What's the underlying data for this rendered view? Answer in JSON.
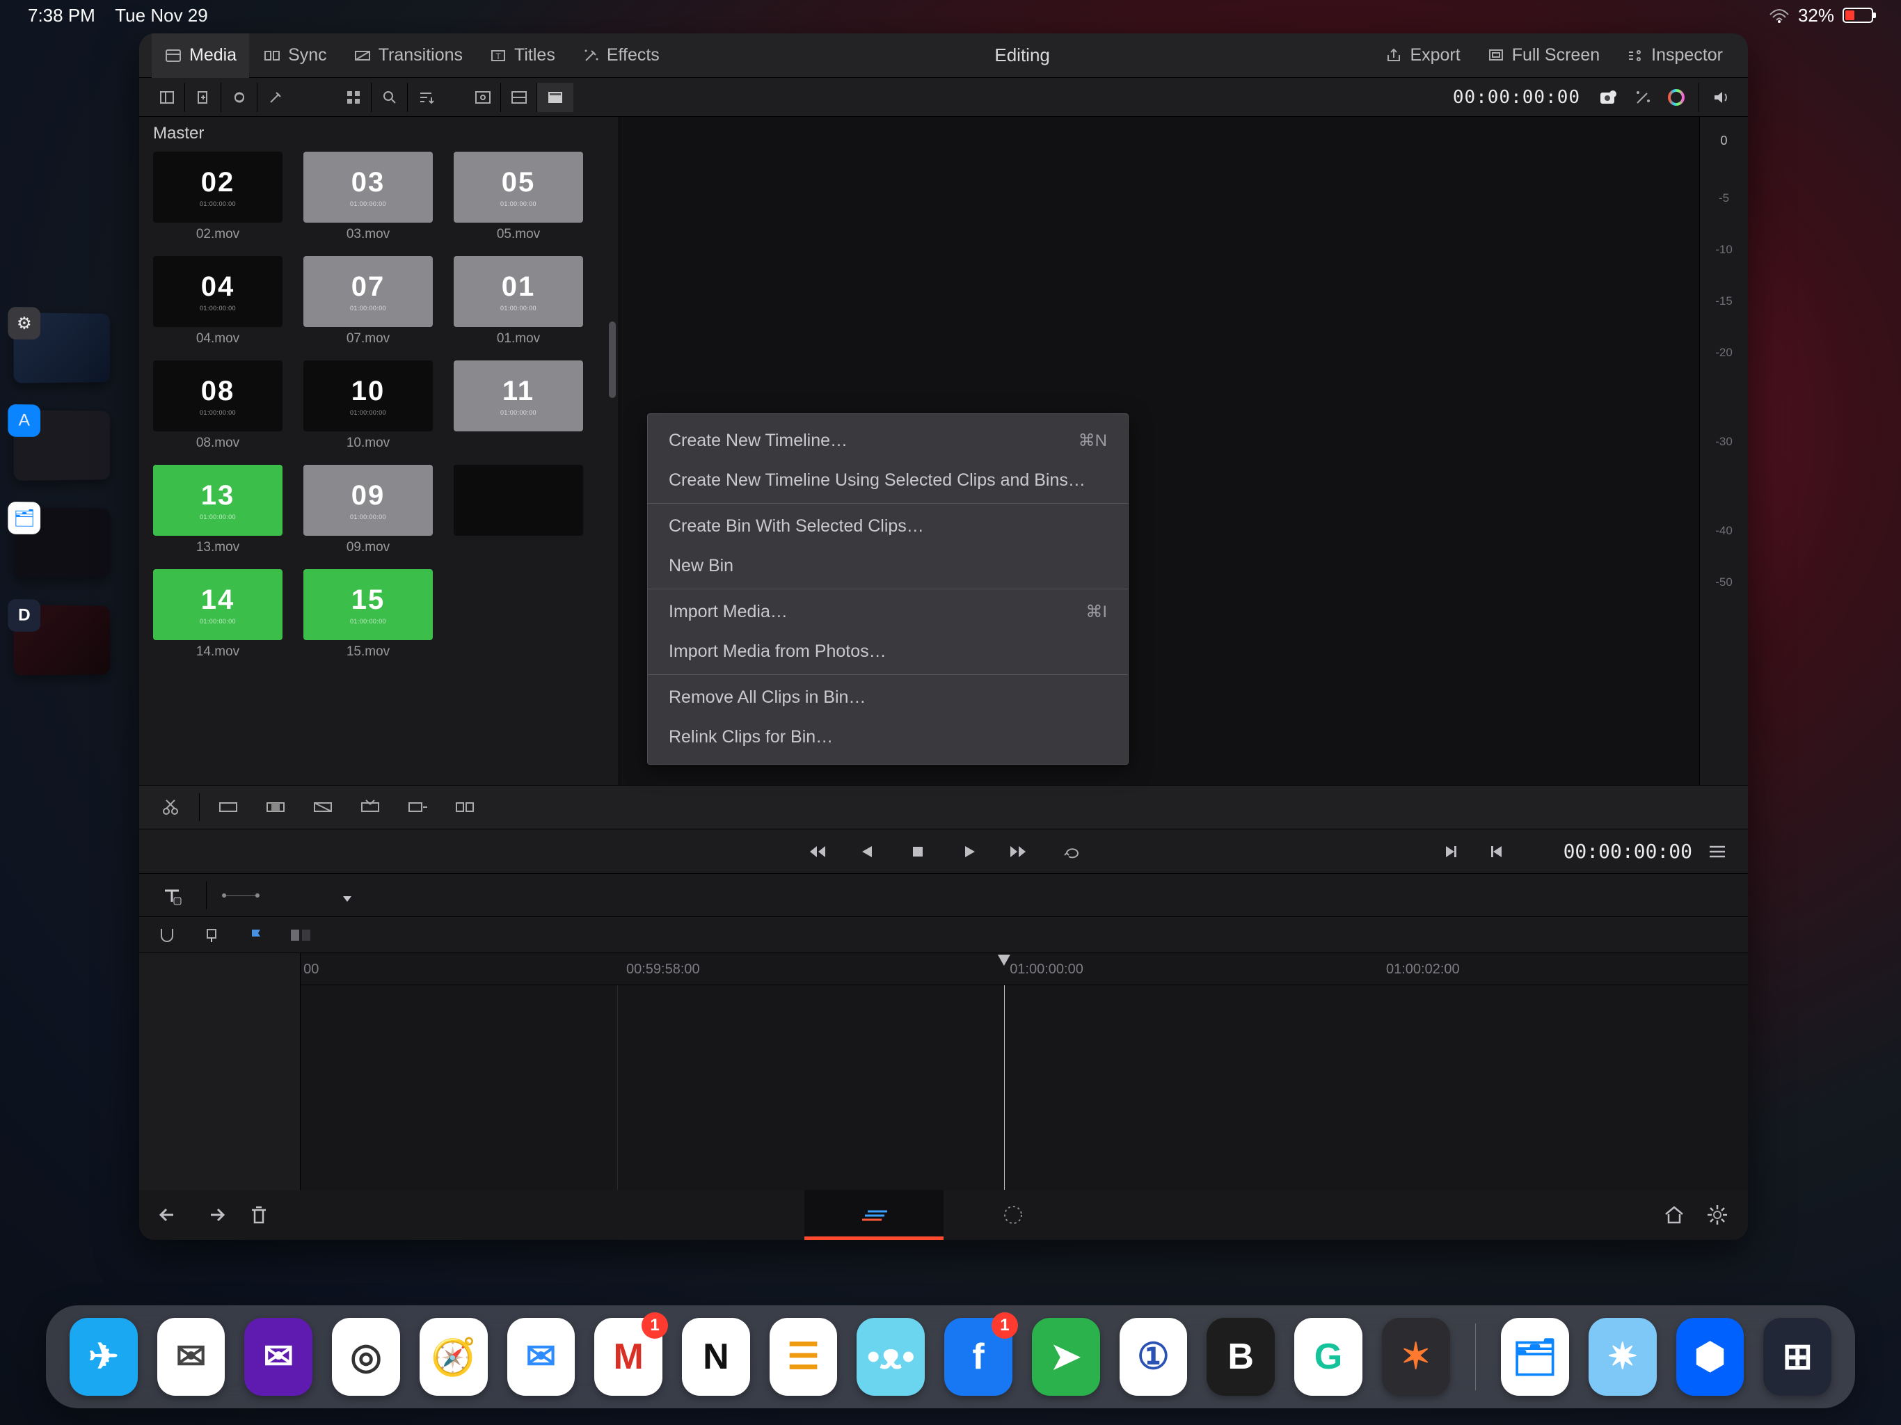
{
  "status": {
    "time": "7:38 PM",
    "date": "Tue Nov 29",
    "battery": "32%"
  },
  "topTabs": {
    "media": "Media",
    "sync": "Sync",
    "transitions": "Transitions",
    "titles": "Titles",
    "effects": "Effects",
    "export": "Export",
    "fullscreen": "Full Screen",
    "inspector": "Inspector"
  },
  "centerTitle": "Editing",
  "timecodeTop": "00:00:00:00",
  "masterLabel": "Master",
  "clips": [
    {
      "num": "02",
      "name": "02.mov",
      "style": "black"
    },
    {
      "num": "03",
      "name": "03.mov",
      "style": "gray"
    },
    {
      "num": "05",
      "name": "05.mov",
      "style": "gray"
    },
    {
      "num": "04",
      "name": "04.mov",
      "style": "black"
    },
    {
      "num": "07",
      "name": "07.mov",
      "style": "gray"
    },
    {
      "num": "01",
      "name": "01.mov",
      "style": "gray"
    },
    {
      "num": "08",
      "name": "08.mov",
      "style": "black"
    },
    {
      "num": "10",
      "name": "10.mov",
      "style": "black"
    },
    {
      "num": "11",
      "name": "",
      "style": "gray"
    },
    {
      "num": "13",
      "name": "13.mov",
      "style": "green"
    },
    {
      "num": "09",
      "name": "09.mov",
      "style": "gray"
    },
    {
      "num": "",
      "name": "",
      "style": "black"
    },
    {
      "num": "14",
      "name": "14.mov",
      "style": "green"
    },
    {
      "num": "15",
      "name": "15.mov",
      "style": "green"
    }
  ],
  "meters": {
    "zero": "0",
    "ticks": [
      "-5",
      "-10",
      "-15",
      "-20",
      "",
      "-30",
      "",
      "-40",
      "-50"
    ]
  },
  "contextMenu": [
    {
      "label": "Create New Timeline…",
      "shortcut": "⌘N"
    },
    {
      "label": "Create New Timeline Using Selected Clips and Bins…"
    },
    {
      "sep": true
    },
    {
      "label": "Create Bin With Selected Clips…"
    },
    {
      "label": "New Bin"
    },
    {
      "sep": true
    },
    {
      "label": "Import Media…",
      "shortcut": "⌘I"
    },
    {
      "label": "Import Media from Photos…"
    },
    {
      "sep": true
    },
    {
      "label": "Remove All Clips in Bin…"
    },
    {
      "label": "Relink Clips for Bin…"
    }
  ],
  "transport": {
    "timecode": "00:00:00:00"
  },
  "ruler": {
    "labels": [
      {
        "text": "00",
        "pct": 0.2
      },
      {
        "text": "00:59:58:00",
        "pct": 22.5
      },
      {
        "text": "01:00:00:00",
        "pct": 49.0
      },
      {
        "text": "01:00:02:00",
        "pct": 75.0
      }
    ],
    "playheadPct": 48.6
  },
  "dock": {
    "apps": [
      {
        "name": "spark",
        "bg": "#1aa8f2",
        "glyph": "✈︎"
      },
      {
        "name": "mail-yb",
        "bg": "#ffffff",
        "glyph": "✉︎",
        "fg": "#444"
      },
      {
        "name": "yahoo",
        "bg": "#5f1ab0",
        "glyph": "✉︎"
      },
      {
        "name": "chrome",
        "bg": "#ffffff",
        "glyph": "◎",
        "fg": "#333"
      },
      {
        "name": "safari",
        "bg": "#ffffff",
        "glyph": "🧭"
      },
      {
        "name": "apple-mail",
        "bg": "#ffffff",
        "glyph": "✉︎",
        "fg": "#2e8cff"
      },
      {
        "name": "gmail",
        "bg": "#ffffff",
        "glyph": "M",
        "fg": "#d93025",
        "badge": "1"
      },
      {
        "name": "notion",
        "bg": "#ffffff",
        "glyph": "N",
        "fg": "#111"
      },
      {
        "name": "calendar",
        "bg": "#ffffff",
        "glyph": "☰",
        "fg": "#f09a10"
      },
      {
        "name": "tweetbot",
        "bg": "#6bd4ef",
        "glyph": "•ᴥ•"
      },
      {
        "name": "facebook",
        "bg": "#1877f2",
        "glyph": "f",
        "badge": "1"
      },
      {
        "name": "feedly",
        "bg": "#2bb24c",
        "glyph": "➤"
      },
      {
        "name": "1password",
        "bg": "#ffffff",
        "glyph": "①",
        "fg": "#2a52b4"
      },
      {
        "name": "bear",
        "bg": "#1d1d1d",
        "glyph": "B"
      },
      {
        "name": "grammarly",
        "bg": "#ffffff",
        "glyph": "G",
        "fg": "#15c39a"
      },
      {
        "name": "resolve",
        "bg": "#2c2c30",
        "glyph": "✶",
        "fg": "#ff7a2e"
      }
    ],
    "recent": [
      {
        "name": "files",
        "bg": "#ffffff",
        "glyph": "🗂",
        "fg": "#0a84ff"
      },
      {
        "name": "shortcuts",
        "bg": "#7ec8f7",
        "glyph": "✷"
      },
      {
        "name": "dropbox",
        "bg": "#0061ff",
        "glyph": "⬢"
      },
      {
        "name": "bundle",
        "bg": "#222738",
        "glyph": "⊞"
      }
    ]
  }
}
